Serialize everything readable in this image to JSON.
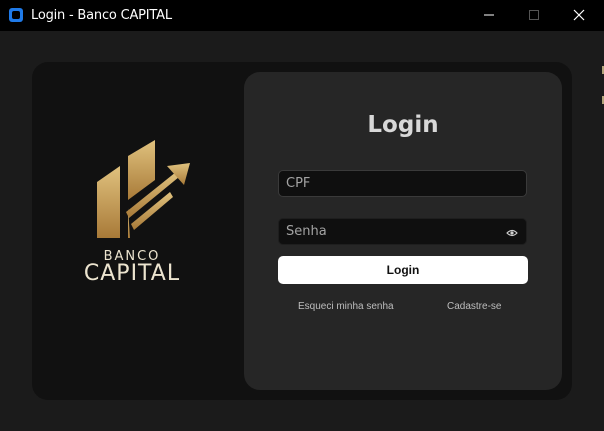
{
  "window": {
    "title": "Login - Banco CAPITAL",
    "icon": "app-icon",
    "controls": [
      "minimize-icon",
      "maximize-icon",
      "close-icon"
    ]
  },
  "brand": {
    "line1": "BANCO",
    "line2": "CAPITAL",
    "colors": {
      "gold": "#c9a35a",
      "text": "#ece4cf"
    }
  },
  "login": {
    "title": "Login",
    "cpf_placeholder": "CPF",
    "cpf_value": "",
    "password_placeholder": "Senha",
    "password_value": "",
    "password_toggle_icon": "eye-icon",
    "submit_label": "Login",
    "forgot_link": "Esqueci minha senha",
    "signup_link": "Cadastre-se"
  },
  "theme": {
    "background": "#1b1b1b",
    "outer_card": "#111111",
    "login_card": "#262626",
    "button": "#ffffff"
  }
}
